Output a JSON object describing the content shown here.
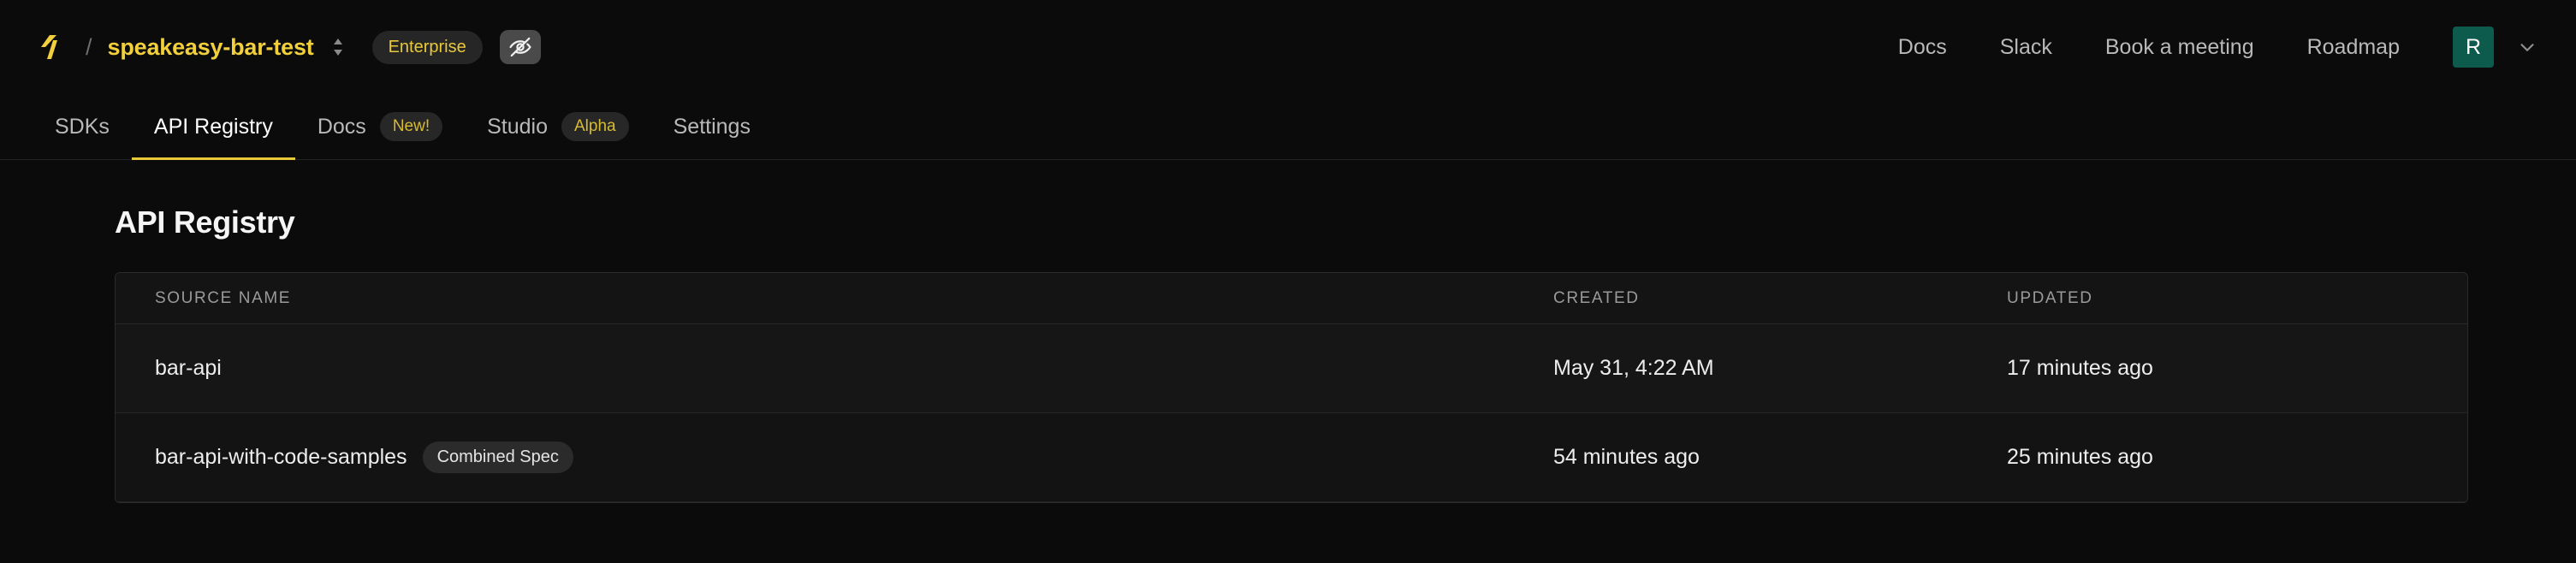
{
  "header": {
    "logo_icon": "speakeasy-logo-icon",
    "breadcrumb_separator": "/",
    "workspace_name": "speakeasy-bar-test",
    "workspace_switcher_icon": "chevron-up-down-icon",
    "plan_badge": "Enterprise",
    "visibility_icon": "eye-off-icon",
    "nav_links": [
      {
        "label": "Docs"
      },
      {
        "label": "Slack"
      },
      {
        "label": "Book a meeting"
      },
      {
        "label": "Roadmap"
      }
    ],
    "avatar_initial": "R",
    "avatar_color": "#0d5b4c",
    "avatar_caret_icon": "chevron-down-icon"
  },
  "tabs": [
    {
      "label": "SDKs",
      "active": false,
      "pill": null
    },
    {
      "label": "API Registry",
      "active": true,
      "pill": null
    },
    {
      "label": "Docs",
      "active": false,
      "pill": "New!"
    },
    {
      "label": "Studio",
      "active": false,
      "pill": "Alpha"
    },
    {
      "label": "Settings",
      "active": false,
      "pill": null
    }
  ],
  "main": {
    "page_title": "API Registry",
    "table": {
      "columns": [
        "SOURCE NAME",
        "CREATED",
        "UPDATED"
      ],
      "rows": [
        {
          "source_name": "bar-api",
          "tag": null,
          "created": "May 31, 4:22 AM",
          "updated": "17 minutes ago"
        },
        {
          "source_name": "bar-api-with-code-samples",
          "tag": "Combined Spec",
          "created": "54 minutes ago",
          "updated": "25 minutes ago"
        }
      ]
    }
  },
  "colors": {
    "background": "#0b0b0b",
    "accent_yellow": "#f2d03b",
    "accent_green": "#0d5b4c",
    "table_bg": "#161616",
    "border": "#2a2a2a"
  }
}
